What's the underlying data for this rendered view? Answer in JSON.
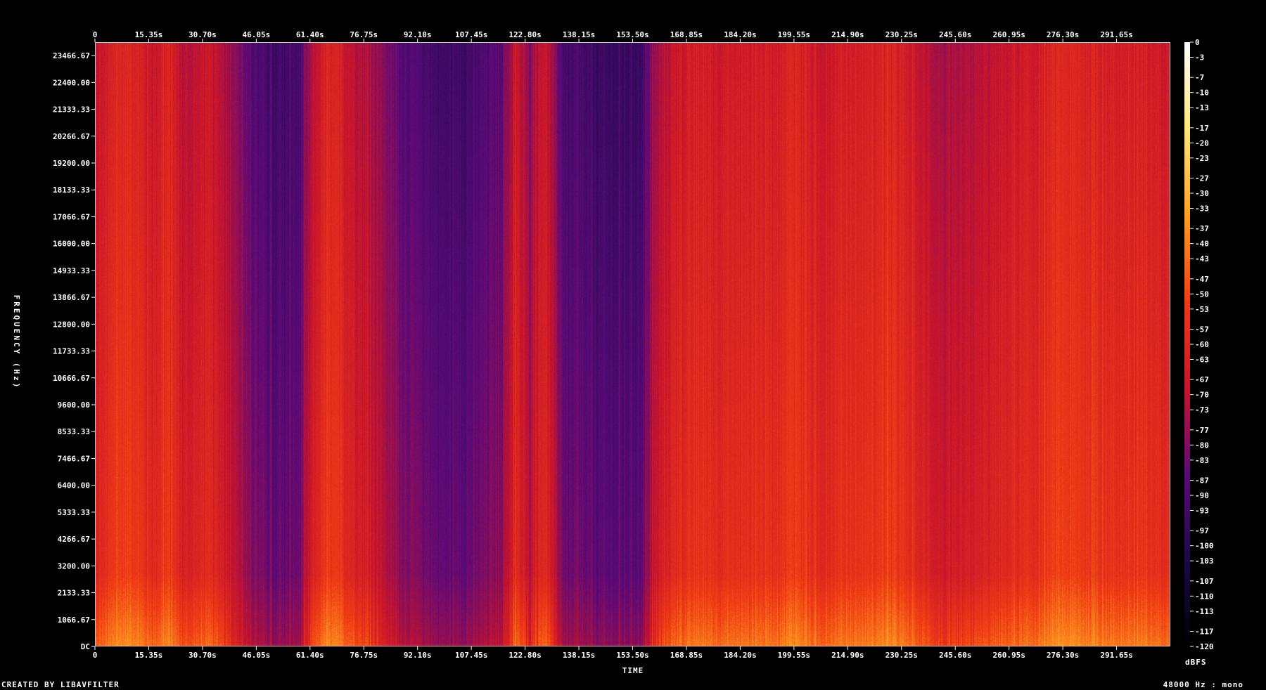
{
  "chart_data": {
    "type": "heatmap",
    "title": "",
    "xlabel": "TIME",
    "ylabel": "FREQUENCY (Hz)",
    "x_tick_labels": [
      "0",
      "15.35s",
      "30.70s",
      "46.05s",
      "61.40s",
      "76.75s",
      "92.10s",
      "107.45s",
      "122.80s",
      "138.15s",
      "153.50s",
      "168.85s",
      "184.20s",
      "199.55s",
      "214.90s",
      "230.25s",
      "245.60s",
      "260.95s",
      "276.30s",
      "291.65s"
    ],
    "x_tick_values": [
      0,
      15.35,
      30.7,
      46.05,
      61.4,
      76.75,
      92.1,
      107.45,
      122.8,
      138.15,
      153.5,
      168.85,
      184.2,
      199.55,
      214.9,
      230.25,
      245.6,
      260.95,
      276.3,
      291.65
    ],
    "xlim": [
      0,
      307
    ],
    "y_tick_labels": [
      "DC",
      "1066.67",
      "2133.33",
      "3200.00",
      "4266.67",
      "5333.33",
      "6400.00",
      "7466.67",
      "8533.33",
      "9600.00",
      "10666.67",
      "11733.33",
      "12800.00",
      "13866.67",
      "14933.33",
      "16000.00",
      "17066.67",
      "18133.33",
      "19200.00",
      "20266.67",
      "21333.33",
      "22400.00",
      "23466.67"
    ],
    "y_tick_values": [
      0,
      1066.67,
      2133.33,
      3200.0,
      4266.67,
      5333.33,
      6400.0,
      7466.67,
      8533.33,
      9600.0,
      10666.67,
      11733.33,
      12800.0,
      13866.67,
      14933.33,
      16000.0,
      17066.67,
      18133.33,
      19200.0,
      20266.67,
      21333.33,
      22400.0,
      23466.67
    ],
    "ylim": [
      0,
      24000
    ],
    "colorbar": {
      "unit": "dBFS",
      "tick_labels": [
        "0",
        "-3",
        "-7",
        "-10",
        "-13",
        "-17",
        "-20",
        "-23",
        "-27",
        "-30",
        "-33",
        "-37",
        "-40",
        "-43",
        "-47",
        "-50",
        "-53",
        "-57",
        "-60",
        "-63",
        "-67",
        "-70",
        "-73",
        "-77",
        "-80",
        "-83",
        "-87",
        "-90",
        "-93",
        "-97",
        "-100",
        "-103",
        "-107",
        "-110",
        "-113",
        "-117",
        "-120"
      ],
      "tick_values": [
        0,
        -3,
        -7,
        -10,
        -13,
        -17,
        -20,
        -23,
        -27,
        -30,
        -33,
        -37,
        -40,
        -43,
        -47,
        -50,
        -53,
        -57,
        -60,
        -63,
        -67,
        -70,
        -73,
        -77,
        -80,
        -83,
        -87,
        -90,
        -93,
        -97,
        -100,
        -103,
        -107,
        -110,
        -113,
        -117,
        -120
      ],
      "range": [
        -120,
        0
      ],
      "colors": [
        "#000000",
        "#1a0a4a",
        "#5c0a7a",
        "#c8142c",
        "#f03c14",
        "#ffa020",
        "#ffe878",
        "#ffffff"
      ]
    },
    "time_loudness_profile": {
      "time_s": [
        0,
        6,
        10,
        16,
        21,
        25,
        32,
        38,
        44,
        50,
        58,
        62,
        66,
        70,
        74,
        80,
        86,
        92,
        100,
        108,
        116,
        120,
        124,
        128,
        134,
        140,
        148,
        156,
        160,
        165,
        172,
        180,
        188,
        196,
        200,
        206,
        212,
        220,
        228,
        236,
        244,
        252,
        260,
        268,
        276,
        282,
        290,
        300,
        307
      ],
      "level_db": [
        -60,
        -52,
        -50,
        -58,
        -52,
        -62,
        -58,
        -64,
        -78,
        -84,
        -82,
        -62,
        -52,
        -56,
        -60,
        -66,
        -76,
        -80,
        -84,
        -82,
        -76,
        -58,
        -70,
        -56,
        -82,
        -84,
        -86,
        -84,
        -66,
        -58,
        -55,
        -56,
        -55,
        -54,
        -50,
        -58,
        -55,
        -54,
        -52,
        -60,
        -66,
        -62,
        -58,
        -56,
        -50,
        -52,
        -54,
        -55,
        -55
      ]
    }
  },
  "footer": {
    "credit": "CREATED BY LIBAVFILTER",
    "sample_info": "48000 Hz : mono"
  }
}
